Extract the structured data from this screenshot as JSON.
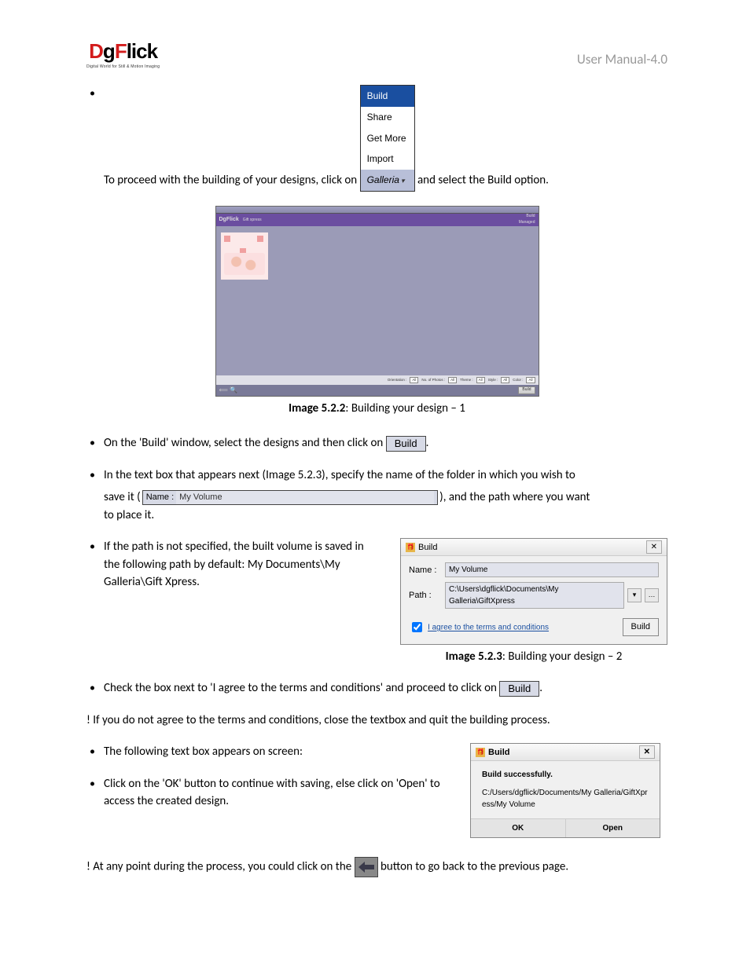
{
  "header": {
    "logo_brand": "DgFlick",
    "logo_tag": "Digital World for Still & Motion Imaging",
    "manual_label": "User Manual-4.0"
  },
  "menu": {
    "items": [
      "Build",
      "Share",
      "Get More",
      "Import",
      "Galleria"
    ]
  },
  "steps": {
    "s1_pre": "To proceed with the building of your designs, click on ",
    "s1_post": " and select the Build option.",
    "s2_pre": "On the 'Build' window, select the designs and then click on",
    "s2_post": ".",
    "s3_line": "In the text box that appears next (Image 5.2.3), specify the name of the folder in which you wish to",
    "s3_save_pre": "save it (",
    "s3_save_post": "), and the path where you want",
    "s3_save_tail": "to place it.",
    "s4": "If the path is not specified, the built volume is saved in the following path by default: My Documents\\My Galleria\\Gift Xpress.",
    "s5_pre": "Check the box next to 'I agree to the terms and conditions' and proceed to click on",
    "s5_post": ".",
    "s6": "! If you do not agree to the terms and conditions, close the textbox and quit the building process.",
    "s7": "The following text box appears on screen:",
    "s8": "Click on the 'OK' button to continue with saving, else click on 'Open' to access the created design.",
    "s9_pre": "! At any point during the process, you could click on the ",
    "s9_post": "button to go back to the previous page."
  },
  "captions": {
    "c1_bold": "Image 5.2.2",
    "c1_rest": ": Building your design – 1",
    "c2_bold": "Image 5.2.3",
    "c2_rest": ": Building your design – 2"
  },
  "appwin": {
    "brand": "DgFlick",
    "sub": "Gift xpress",
    "top_right_1": "Build",
    "top_right_2": "Managed",
    "filters": {
      "orientation_lbl": "Orientation :",
      "orientation_val": "All",
      "nphotos_lbl": "No. of Photos :",
      "nphotos_val": "All",
      "theme_lbl": "Theme :",
      "theme_val": "All",
      "style_lbl": "Style :",
      "style_val": "All",
      "color_lbl": "Color :",
      "color_val": "All"
    },
    "bottom_build": "Build"
  },
  "name_field": {
    "label": "Name :",
    "value": "My Volume"
  },
  "dialog1": {
    "title": "Build",
    "name_label": "Name :",
    "name_value": "My Volume",
    "path_label": "Path :",
    "path_value": "C:\\Users\\dgflick\\Documents\\My Galleria\\GiftXpress",
    "agree": "I agree to the terms and conditions",
    "build_btn": "Build"
  },
  "build_btn_label": "Build",
  "dialog2": {
    "title": "Build",
    "msg": "Build successfully.",
    "path": "C:/Users/dgflick/Documents/My Galleria/GiftXpress/My Volume",
    "ok": "OK",
    "open": "Open"
  }
}
